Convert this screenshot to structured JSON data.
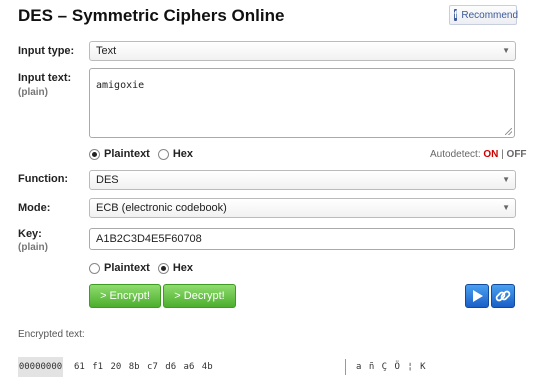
{
  "title": "DES – Symmetric Ciphers Online",
  "facebook": {
    "label": "Recommend",
    "logo": "f"
  },
  "input_type": {
    "label": "Input type:",
    "value": "Text"
  },
  "input_text": {
    "label": "Input text:",
    "sublabel": "(plain)",
    "value": "amigoxie"
  },
  "input_format": {
    "plaintext": "Plaintext",
    "hex": "Hex",
    "selected": "plaintext"
  },
  "autodetect": {
    "label": "Autodetect:",
    "on": "ON",
    "sep": "|",
    "off": "OFF"
  },
  "function": {
    "label": "Function:",
    "value": "DES"
  },
  "mode": {
    "label": "Mode:",
    "value": "ECB (electronic codebook)"
  },
  "key": {
    "label": "Key:",
    "sublabel": "(plain)",
    "value": "A1B2C3D4E5F60708"
  },
  "key_format": {
    "plaintext": "Plaintext",
    "hex": "Hex",
    "selected": "hex"
  },
  "buttons": {
    "encrypt": "> Encrypt!",
    "decrypt": "> Decrypt!"
  },
  "encrypted": {
    "label": "Encrypted text:",
    "offset": "00000000",
    "bytes": "61 f1 20 8b c7 d6 a6 4b",
    "ascii": "a ñ   Ç Ö ¦ K"
  },
  "icons": {
    "play": "play-icon",
    "link": "link-icon"
  },
  "colors": {
    "button_green": "#4cae2c",
    "button_blue": "#1a5fc8",
    "on_red": "#cc0000"
  }
}
